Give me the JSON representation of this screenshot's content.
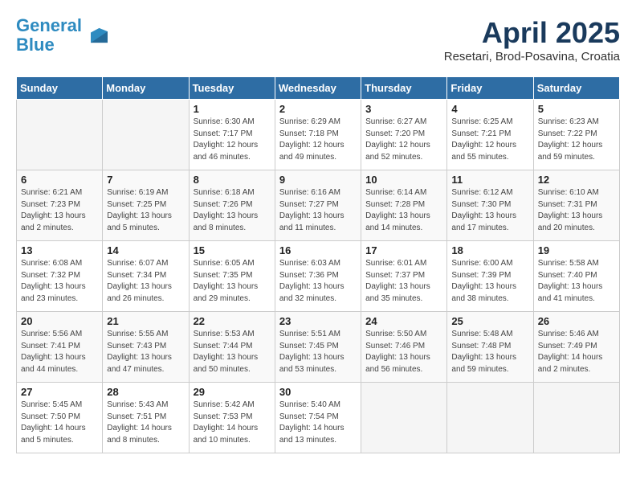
{
  "logo": {
    "line1": "General",
    "line2": "Blue"
  },
  "title": "April 2025",
  "location": "Resetari, Brod-Posavina, Croatia",
  "days_header": [
    "Sunday",
    "Monday",
    "Tuesday",
    "Wednesday",
    "Thursday",
    "Friday",
    "Saturday"
  ],
  "weeks": [
    [
      {
        "day": "",
        "text": ""
      },
      {
        "day": "",
        "text": ""
      },
      {
        "day": "1",
        "text": "Sunrise: 6:30 AM\nSunset: 7:17 PM\nDaylight: 12 hours and 46 minutes."
      },
      {
        "day": "2",
        "text": "Sunrise: 6:29 AM\nSunset: 7:18 PM\nDaylight: 12 hours and 49 minutes."
      },
      {
        "day": "3",
        "text": "Sunrise: 6:27 AM\nSunset: 7:20 PM\nDaylight: 12 hours and 52 minutes."
      },
      {
        "day": "4",
        "text": "Sunrise: 6:25 AM\nSunset: 7:21 PM\nDaylight: 12 hours and 55 minutes."
      },
      {
        "day": "5",
        "text": "Sunrise: 6:23 AM\nSunset: 7:22 PM\nDaylight: 12 hours and 59 minutes."
      }
    ],
    [
      {
        "day": "6",
        "text": "Sunrise: 6:21 AM\nSunset: 7:23 PM\nDaylight: 13 hours and 2 minutes."
      },
      {
        "day": "7",
        "text": "Sunrise: 6:19 AM\nSunset: 7:25 PM\nDaylight: 13 hours and 5 minutes."
      },
      {
        "day": "8",
        "text": "Sunrise: 6:18 AM\nSunset: 7:26 PM\nDaylight: 13 hours and 8 minutes."
      },
      {
        "day": "9",
        "text": "Sunrise: 6:16 AM\nSunset: 7:27 PM\nDaylight: 13 hours and 11 minutes."
      },
      {
        "day": "10",
        "text": "Sunrise: 6:14 AM\nSunset: 7:28 PM\nDaylight: 13 hours and 14 minutes."
      },
      {
        "day": "11",
        "text": "Sunrise: 6:12 AM\nSunset: 7:30 PM\nDaylight: 13 hours and 17 minutes."
      },
      {
        "day": "12",
        "text": "Sunrise: 6:10 AM\nSunset: 7:31 PM\nDaylight: 13 hours and 20 minutes."
      }
    ],
    [
      {
        "day": "13",
        "text": "Sunrise: 6:08 AM\nSunset: 7:32 PM\nDaylight: 13 hours and 23 minutes."
      },
      {
        "day": "14",
        "text": "Sunrise: 6:07 AM\nSunset: 7:34 PM\nDaylight: 13 hours and 26 minutes."
      },
      {
        "day": "15",
        "text": "Sunrise: 6:05 AM\nSunset: 7:35 PM\nDaylight: 13 hours and 29 minutes."
      },
      {
        "day": "16",
        "text": "Sunrise: 6:03 AM\nSunset: 7:36 PM\nDaylight: 13 hours and 32 minutes."
      },
      {
        "day": "17",
        "text": "Sunrise: 6:01 AM\nSunset: 7:37 PM\nDaylight: 13 hours and 35 minutes."
      },
      {
        "day": "18",
        "text": "Sunrise: 6:00 AM\nSunset: 7:39 PM\nDaylight: 13 hours and 38 minutes."
      },
      {
        "day": "19",
        "text": "Sunrise: 5:58 AM\nSunset: 7:40 PM\nDaylight: 13 hours and 41 minutes."
      }
    ],
    [
      {
        "day": "20",
        "text": "Sunrise: 5:56 AM\nSunset: 7:41 PM\nDaylight: 13 hours and 44 minutes."
      },
      {
        "day": "21",
        "text": "Sunrise: 5:55 AM\nSunset: 7:43 PM\nDaylight: 13 hours and 47 minutes."
      },
      {
        "day": "22",
        "text": "Sunrise: 5:53 AM\nSunset: 7:44 PM\nDaylight: 13 hours and 50 minutes."
      },
      {
        "day": "23",
        "text": "Sunrise: 5:51 AM\nSunset: 7:45 PM\nDaylight: 13 hours and 53 minutes."
      },
      {
        "day": "24",
        "text": "Sunrise: 5:50 AM\nSunset: 7:46 PM\nDaylight: 13 hours and 56 minutes."
      },
      {
        "day": "25",
        "text": "Sunrise: 5:48 AM\nSunset: 7:48 PM\nDaylight: 13 hours and 59 minutes."
      },
      {
        "day": "26",
        "text": "Sunrise: 5:46 AM\nSunset: 7:49 PM\nDaylight: 14 hours and 2 minutes."
      }
    ],
    [
      {
        "day": "27",
        "text": "Sunrise: 5:45 AM\nSunset: 7:50 PM\nDaylight: 14 hours and 5 minutes."
      },
      {
        "day": "28",
        "text": "Sunrise: 5:43 AM\nSunset: 7:51 PM\nDaylight: 14 hours and 8 minutes."
      },
      {
        "day": "29",
        "text": "Sunrise: 5:42 AM\nSunset: 7:53 PM\nDaylight: 14 hours and 10 minutes."
      },
      {
        "day": "30",
        "text": "Sunrise: 5:40 AM\nSunset: 7:54 PM\nDaylight: 14 hours and 13 minutes."
      },
      {
        "day": "",
        "text": ""
      },
      {
        "day": "",
        "text": ""
      },
      {
        "day": "",
        "text": ""
      }
    ]
  ]
}
